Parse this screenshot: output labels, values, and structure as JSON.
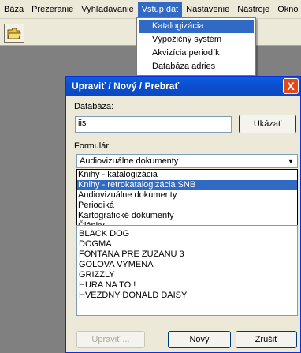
{
  "menubar": {
    "items": [
      "Báza",
      "Prezeranie",
      "Vyhľadávanie",
      "Vstup dát",
      "Nastavenie",
      "Nástroje",
      "Okno"
    ]
  },
  "dropdown": {
    "items": [
      "Katalogizácia",
      "Výpožičný systém",
      "Akvizícia periodík",
      "Databáza adries"
    ]
  },
  "dialog": {
    "title": "Upraviť / Nový / Prebrať",
    "close_label": "X",
    "database_label": "Databáza:",
    "database_value": "iis",
    "show_button": "Ukázať",
    "form_label": "Formulár:",
    "form_value": "Audiovizuálne dokumenty",
    "form_options": [
      "Knihy - katalogizácia",
      "Knihy - retrokatalogizácia SNB",
      "Audiovizuálne dokumenty",
      "Periodiká",
      "Kartografické dokumenty",
      "Články"
    ],
    "records": [
      "BLACK DOG",
      "DOGMA",
      "FONTANA PRE ZUZANU 3",
      "GOLOVA VYMENA",
      "GRIZZLY",
      "HURA NA TO !",
      "HVEZDNY DONALD DAISY"
    ],
    "buttons": {
      "edit": "Upraviť ...",
      "new": "Nový",
      "cancel": "Zrušiť"
    }
  }
}
